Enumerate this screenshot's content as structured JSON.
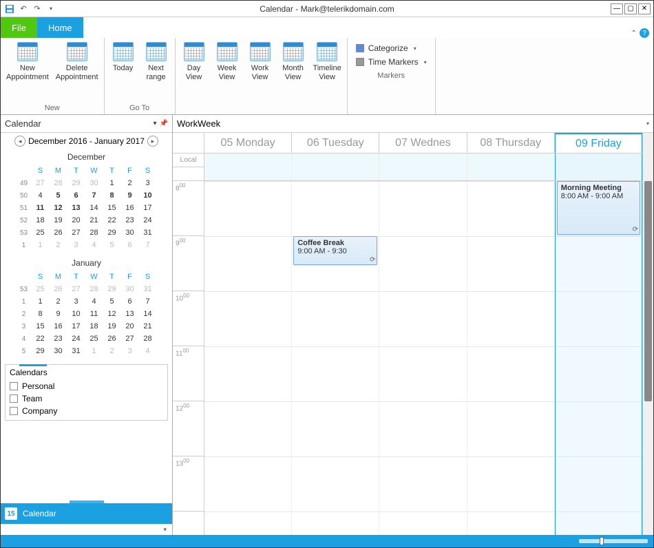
{
  "window": {
    "title": "Calendar - Mark@telerikdomain.com"
  },
  "tabs": {
    "file": "File",
    "home": "Home"
  },
  "ribbon": {
    "new": {
      "label": "New",
      "new_appointment_l1": "New",
      "new_appointment_l2": "Appointment",
      "delete_appointment_l1": "Delete",
      "delete_appointment_l2": "Appointment"
    },
    "goto": {
      "label": "Go To",
      "today": "Today",
      "next_l1": "Next",
      "next_l2": "range"
    },
    "views": {
      "day_l1": "Day",
      "day_l2": "View",
      "week_l1": "Week",
      "week_l2": "View",
      "work_l1": "Work",
      "work_l2": "View",
      "month_l1": "Month",
      "month_l2": "View",
      "timeline_l1": "Timeline",
      "timeline_l2": "View"
    },
    "markers": {
      "label": "Markers",
      "categorize": "Categorize",
      "time_markers": "Time Markers"
    }
  },
  "left": {
    "header": "Calendar",
    "range": "December 2016 - January 2017",
    "december": {
      "title": "December",
      "dow": [
        "S",
        "M",
        "T",
        "W",
        "T",
        "F",
        "S"
      ],
      "rows": [
        {
          "wk": "49",
          "days": [
            {
              "d": "27",
              "o": true
            },
            {
              "d": "28",
              "o": true
            },
            {
              "d": "29",
              "o": true
            },
            {
              "d": "30",
              "o": true
            },
            {
              "d": "1"
            },
            {
              "d": "2"
            },
            {
              "d": "3"
            }
          ]
        },
        {
          "wk": "50",
          "days": [
            {
              "d": "4"
            },
            {
              "d": "5",
              "b": true
            },
            {
              "d": "6",
              "b": true
            },
            {
              "d": "7",
              "b": true
            },
            {
              "d": "8",
              "b": true
            },
            {
              "d": "9",
              "b": true
            },
            {
              "d": "10",
              "b": true
            }
          ]
        },
        {
          "wk": "51",
          "days": [
            {
              "d": "11",
              "b": true
            },
            {
              "d": "12",
              "b": true
            },
            {
              "d": "13",
              "b": true
            },
            {
              "d": "14"
            },
            {
              "d": "15"
            },
            {
              "d": "16"
            },
            {
              "d": "17"
            }
          ]
        },
        {
          "wk": "52",
          "days": [
            {
              "d": "18"
            },
            {
              "d": "19"
            },
            {
              "d": "20"
            },
            {
              "d": "21"
            },
            {
              "d": "22"
            },
            {
              "d": "23"
            },
            {
              "d": "24"
            }
          ]
        },
        {
          "wk": "53",
          "days": [
            {
              "d": "25"
            },
            {
              "d": "26"
            },
            {
              "d": "27"
            },
            {
              "d": "28"
            },
            {
              "d": "29"
            },
            {
              "d": "30"
            },
            {
              "d": "31"
            }
          ]
        },
        {
          "wk": "1",
          "days": [
            {
              "d": "1",
              "o": true
            },
            {
              "d": "2",
              "o": true
            },
            {
              "d": "3",
              "o": true
            },
            {
              "d": "4",
              "o": true
            },
            {
              "d": "5",
              "o": true
            },
            {
              "d": "6",
              "o": true
            },
            {
              "d": "7",
              "o": true
            }
          ]
        }
      ]
    },
    "january": {
      "title": "January",
      "dow": [
        "S",
        "M",
        "T",
        "W",
        "T",
        "F",
        "S"
      ],
      "rows": [
        {
          "wk": "53",
          "days": [
            {
              "d": "25",
              "o": true
            },
            {
              "d": "26",
              "o": true
            },
            {
              "d": "27",
              "o": true
            },
            {
              "d": "28",
              "o": true
            },
            {
              "d": "29",
              "o": true
            },
            {
              "d": "30",
              "o": true
            },
            {
              "d": "31",
              "o": true
            }
          ]
        },
        {
          "wk": "1",
          "days": [
            {
              "d": "1"
            },
            {
              "d": "2"
            },
            {
              "d": "3"
            },
            {
              "d": "4"
            },
            {
              "d": "5"
            },
            {
              "d": "6"
            },
            {
              "d": "7"
            }
          ]
        },
        {
          "wk": "2",
          "days": [
            {
              "d": "8"
            },
            {
              "d": "9"
            },
            {
              "d": "10"
            },
            {
              "d": "11"
            },
            {
              "d": "12"
            },
            {
              "d": "13"
            },
            {
              "d": "14"
            }
          ]
        },
        {
          "wk": "3",
          "days": [
            {
              "d": "15"
            },
            {
              "d": "16"
            },
            {
              "d": "17"
            },
            {
              "d": "18"
            },
            {
              "d": "19"
            },
            {
              "d": "20"
            },
            {
              "d": "21"
            }
          ]
        },
        {
          "wk": "4",
          "days": [
            {
              "d": "22"
            },
            {
              "d": "23"
            },
            {
              "d": "24"
            },
            {
              "d": "25"
            },
            {
              "d": "26"
            },
            {
              "d": "27"
            },
            {
              "d": "28"
            }
          ]
        },
        {
          "wk": "5",
          "days": [
            {
              "d": "29"
            },
            {
              "d": "30"
            },
            {
              "d": "31"
            },
            {
              "d": "1",
              "o": true
            },
            {
              "d": "2",
              "o": true
            },
            {
              "d": "3",
              "o": true
            },
            {
              "d": "4",
              "o": true
            }
          ]
        }
      ]
    },
    "calendars": {
      "title": "Calendars",
      "items": [
        "Personal",
        "Team",
        "Company"
      ]
    },
    "navbar": {
      "label": "Calendar",
      "badge": "15"
    }
  },
  "sched": {
    "header": "WorkWeek",
    "local": "Local",
    "days": [
      "05 Monday",
      "06 Tuesday",
      "07 Wednes",
      "08 Thursday",
      "09 Friday"
    ],
    "today_index": 4,
    "hours": [
      "8",
      "9",
      "10",
      "11",
      "12",
      "13"
    ],
    "appts": {
      "coffee": {
        "title": "Coffee Break",
        "time": "9:00 AM - 9:30"
      },
      "morning": {
        "title": "Morning Meeting",
        "time": "8:00 AM - 9:00 AM"
      }
    }
  }
}
